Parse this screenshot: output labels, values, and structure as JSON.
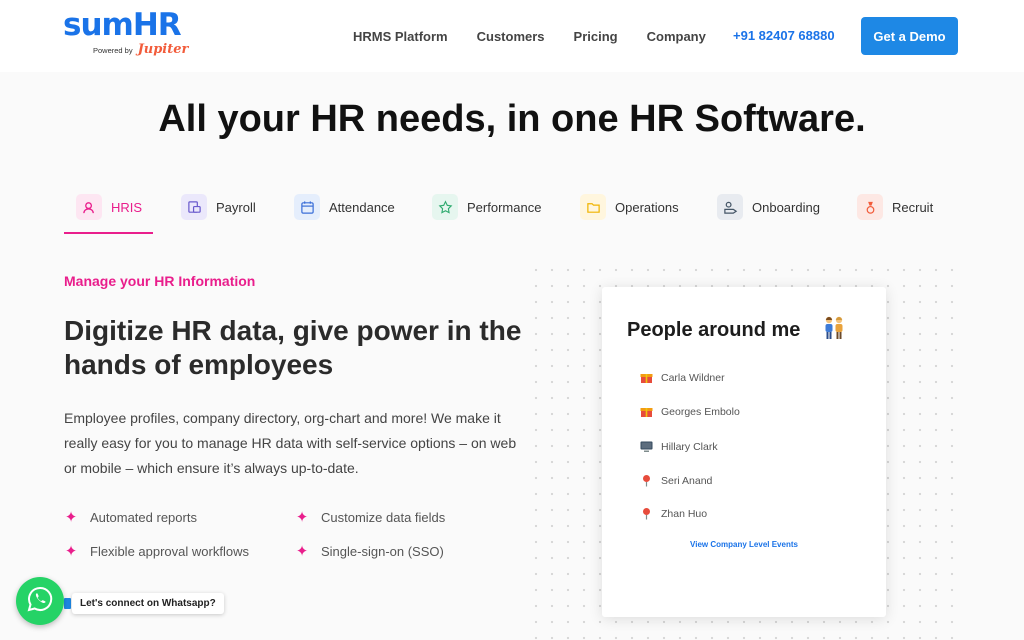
{
  "header": {
    "logo": {
      "brand": "sumHR",
      "powered_by": "Powered by",
      "partner": "Jupiter"
    },
    "nav": [
      {
        "label": "HRMS Platform"
      },
      {
        "label": "Customers"
      },
      {
        "label": "Pricing"
      },
      {
        "label": "Company"
      }
    ],
    "phone": "+91 82407 68880",
    "cta": "Get a Demo"
  },
  "hero": {
    "title": "All your HR needs, in one HR Software."
  },
  "tabs": [
    {
      "label": "HRIS",
      "icon": "user-circle-icon",
      "active": true
    },
    {
      "label": "Payroll",
      "icon": "payroll-icon",
      "active": false
    },
    {
      "label": "Attendance",
      "icon": "calendar-icon",
      "active": false
    },
    {
      "label": "Performance",
      "icon": "star-icon",
      "active": false
    },
    {
      "label": "Operations",
      "icon": "folder-icon",
      "active": false
    },
    {
      "label": "Onboarding",
      "icon": "onboarding-icon",
      "active": false
    },
    {
      "label": "Recruit",
      "icon": "recruit-icon",
      "active": false
    }
  ],
  "content": {
    "eyebrow": "Manage your HR Information",
    "headline": "Digitize HR data, give power in the hands of employees",
    "description": "Employee profiles, company directory, org-chart and more! We make it really easy for you to manage HR data with self-service options – on web or mobile – which ensure it’s always up-to-date.",
    "features": [
      {
        "text": "Automated reports"
      },
      {
        "text": "Customize data fields"
      },
      {
        "text": "Flexible approval workflows"
      },
      {
        "text": "Single-sign-on (SSO)"
      }
    ]
  },
  "card": {
    "title": "People around me",
    "people": [
      {
        "name": "Carla Wildner",
        "icon": "gift-icon"
      },
      {
        "name": "Georges Embolo",
        "icon": "gift-icon"
      },
      {
        "name": "Hillary Clark",
        "icon": "computer-icon"
      },
      {
        "name": "Seri Anand",
        "icon": "pin-icon"
      },
      {
        "name": "Zhan Huo",
        "icon": "pin-icon"
      }
    ],
    "link": "View Company Level Events"
  },
  "whatsapp": {
    "label": "Let's connect on Whatsapp?"
  },
  "colors": {
    "brand": "#1a73e8",
    "accent": "#e91e8c",
    "whatsapp": "#25d366"
  }
}
